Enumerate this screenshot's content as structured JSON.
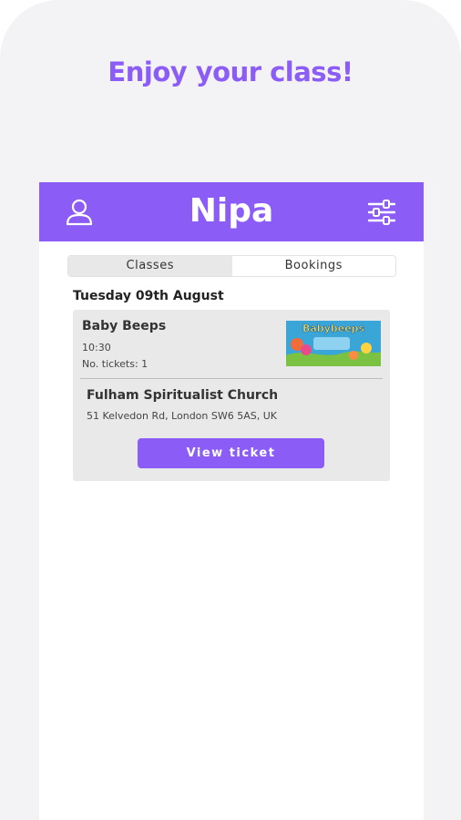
{
  "promo": {
    "headline": "Enjoy your class!"
  },
  "app": {
    "title": "Nipa",
    "brand_color": "#8b5cf6",
    "header_icons": [
      "user-icon",
      "filter-sliders-icon"
    ]
  },
  "tabs": [
    {
      "label": "Classes",
      "active": true
    },
    {
      "label": "Bookings",
      "active": false
    }
  ],
  "booking": {
    "date": "Tuesday 09th August",
    "class_name": "Baby Beeps",
    "time": "10:30",
    "tickets": "No. tickets: 1",
    "thumbnail_text": "Babybeeps",
    "venue_name": "Fulham Spiritualist Church",
    "venue_address": "51 Kelvedon Rd, London SW6 5AS, UK",
    "action_label": "View ticket"
  }
}
